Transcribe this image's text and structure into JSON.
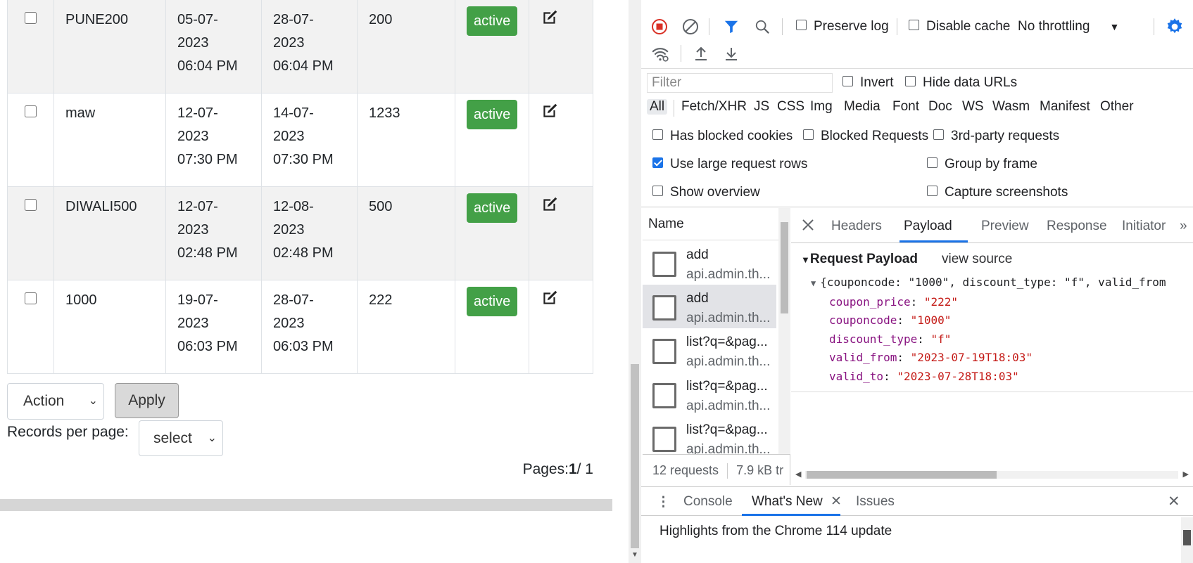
{
  "coupons": [
    {
      "code": "PUNE200",
      "from_date": "05-07-",
      "from_year": "2023",
      "from_time": "06:04 PM",
      "to_date": "28-07-",
      "to_year": "2023",
      "to_time": "06:04 PM",
      "amount": "200",
      "status": "active"
    },
    {
      "code": "maw",
      "from_date": "12-07-",
      "from_year": "2023",
      "from_time": "07:30 PM",
      "to_date": "14-07-",
      "to_year": "2023",
      "to_time": "07:30 PM",
      "amount": "1233",
      "status": "active"
    },
    {
      "code": "DIWALI500",
      "from_date": "12-07-",
      "from_year": "2023",
      "from_time": "02:48 PM",
      "to_date": "12-08-",
      "to_year": "2023",
      "to_time": "02:48 PM",
      "amount": "500",
      "status": "active"
    },
    {
      "code": "1000",
      "from_date": "19-07-",
      "from_year": "2023",
      "from_time": "06:03 PM",
      "to_date": "28-07-",
      "to_year": "2023",
      "to_time": "06:03 PM",
      "amount": "222",
      "status": "active"
    }
  ],
  "bulk": {
    "action_label": "Action",
    "apply_label": "Apply"
  },
  "pagination": {
    "records_label": "Records per page:",
    "records_value": "select",
    "pages_label": "Pages:",
    "current": "1",
    "total": "/ 1"
  },
  "devtools": {
    "toolbar": {
      "preserve_log": "Preserve log",
      "disable_cache": "Disable cache",
      "throttling": "No throttling"
    },
    "filter": {
      "placeholder": "Filter",
      "invert": "Invert",
      "hide_data_urls": "Hide data URLs"
    },
    "types": [
      "All",
      "Fetch/XHR",
      "JS",
      "CSS",
      "Img",
      "Media",
      "Font",
      "Doc",
      "WS",
      "Wasm",
      "Manifest",
      "Other"
    ],
    "options": {
      "has_blocked_cookies": "Has blocked cookies",
      "blocked_requests": "Blocked Requests",
      "third_party": "3rd-party requests",
      "large_rows": "Use large request rows",
      "group_by_frame": "Group by frame",
      "show_overview": "Show overview",
      "capture_screenshots": "Capture screenshots"
    },
    "request_list": {
      "header": "Name",
      "items": [
        {
          "name": "add",
          "host": "api.admin.th..."
        },
        {
          "name": "add",
          "host": "api.admin.th..."
        },
        {
          "name": "list?q=&pag...",
          "host": "api.admin.th..."
        },
        {
          "name": "list?q=&pag...",
          "host": "api.admin.th..."
        },
        {
          "name": "list?q=&pag...",
          "host": "api.admin.th..."
        }
      ],
      "footer_requests": "12 requests",
      "footer_size": "7.9 kB tr"
    },
    "detail_tabs": [
      "Headers",
      "Payload",
      "Preview",
      "Response",
      "Initiator"
    ],
    "payload": {
      "section_title": "Request Payload",
      "view_source": "view source",
      "summary": "{couponcode: \"1000\", discount_type: \"f\", valid_from",
      "fields": [
        {
          "key": "coupon_price",
          "value": "\"222\""
        },
        {
          "key": "couponcode",
          "value": "\"1000\""
        },
        {
          "key": "discount_type",
          "value": "\"f\""
        },
        {
          "key": "valid_from",
          "value": "\"2023-07-19T18:03\""
        },
        {
          "key": "valid_to",
          "value": "\"2023-07-28T18:03\""
        }
      ]
    },
    "drawer": {
      "tabs": [
        "Console",
        "What's New",
        "Issues"
      ],
      "body": "Highlights from the Chrome 114 update"
    }
  }
}
